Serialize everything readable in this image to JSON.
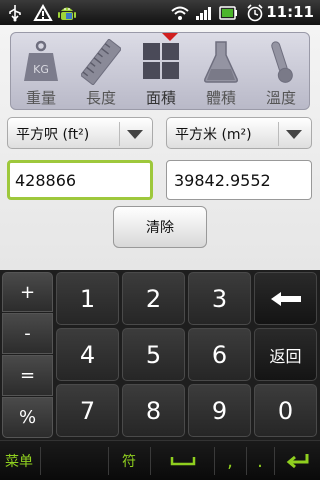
{
  "status_bar": {
    "time": "11:11",
    "icons": [
      "usb-icon",
      "warning-icon",
      "android-icon",
      "wifi-icon",
      "signal-icon",
      "battery-icon",
      "alarm-icon"
    ]
  },
  "categories": [
    {
      "label": "重量",
      "icon": "weight-icon"
    },
    {
      "label": "長度",
      "icon": "ruler-icon"
    },
    {
      "label": "面積",
      "icon": "area-icon",
      "active": true
    },
    {
      "label": "體積",
      "icon": "flask-icon"
    },
    {
      "label": "溫度",
      "icon": "thermometer-icon"
    }
  ],
  "from_unit": "平方呎 (ft²)",
  "to_unit": "平方米 (m²)",
  "from_value": "428866",
  "to_value": "39842.9552",
  "clear_label": "清除",
  "operators": [
    "+",
    "-",
    "=",
    "%"
  ],
  "digits": [
    [
      "1",
      "2",
      "3"
    ],
    [
      "4",
      "5",
      "6"
    ],
    [
      "7",
      "8",
      "9"
    ]
  ],
  "zero": "0",
  "back_label": "返回",
  "keyboard_bar": {
    "menu": "菜单",
    "symbols": "符",
    "comma": ",",
    "period": "."
  },
  "colors": {
    "accent_green": "#8fcf1f",
    "focus_border": "#9ec83c",
    "pointer_red": "#d01f1f"
  }
}
